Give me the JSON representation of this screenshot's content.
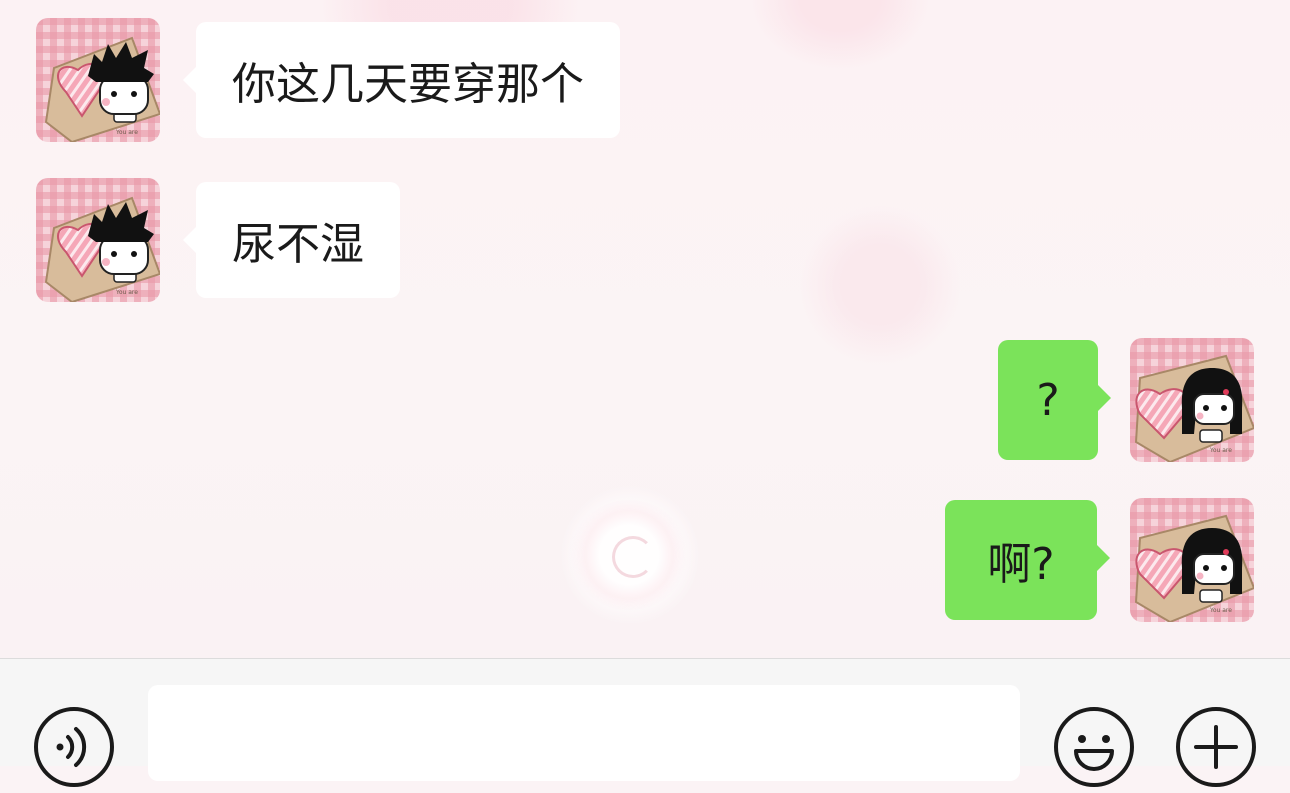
{
  "theme": {
    "sent_bubble_color": "#7be35a",
    "received_bubble_color": "#ffffff",
    "input_bar_color": "#f6f6f6"
  },
  "messages": [
    {
      "direction": "received",
      "text": "你这几天要穿那个",
      "avatar": "boy-holding-heart-avatar"
    },
    {
      "direction": "received",
      "text": "尿不湿",
      "avatar": "boy-holding-heart-avatar"
    },
    {
      "direction": "sent",
      "text": "?",
      "avatar": "girl-holding-heart-avatar"
    },
    {
      "direction": "sent",
      "text": "啊?",
      "avatar": "girl-holding-heart-avatar"
    }
  ],
  "input_bar": {
    "message_value": "",
    "voice_icon": "voice-icon",
    "emoji_icon": "emoji-icon",
    "plus_icon": "plus-icon"
  }
}
